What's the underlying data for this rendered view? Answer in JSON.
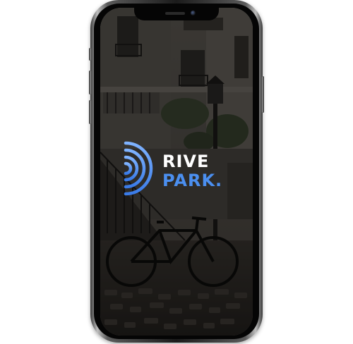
{
  "app": {
    "brand_line1": "RIVE",
    "brand_line2": "PARK."
  },
  "colors": {
    "brand_white": "#ffffff",
    "brand_blue": "#4b8ff0",
    "brand_blue_light": "#7fb3ff",
    "phone_frame": "#1b1b1b"
  },
  "icons": {
    "logo_mark": "signal-waves-icon"
  }
}
